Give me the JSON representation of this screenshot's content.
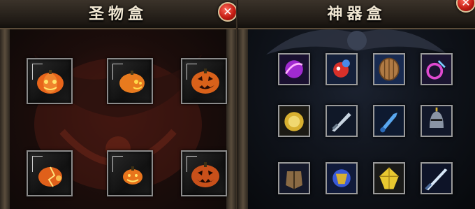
{
  "left_panel": {
    "title": "圣物盒",
    "close_label": "✕",
    "slots": [
      {
        "icon": "jack-o-lantern-glowing-icon"
      },
      {
        "icon": "jack-o-lantern-side-icon"
      },
      {
        "icon": "jack-o-lantern-grin-icon"
      },
      {
        "icon": "jack-o-lantern-cracked-icon"
      },
      {
        "icon": "jack-o-lantern-small-icon"
      },
      {
        "icon": "jack-o-lantern-dark-icon"
      }
    ]
  },
  "right_panel": {
    "title": "神器盒",
    "close_label": "✕",
    "items": [
      {
        "icon": "purple-orb-icon"
      },
      {
        "icon": "red-creature-icon"
      },
      {
        "icon": "wooden-shield-icon"
      },
      {
        "icon": "pink-pendant-icon"
      },
      {
        "icon": "gold-medallion-icon"
      },
      {
        "icon": "steel-sword-icon"
      },
      {
        "icon": "blue-dagger-icon"
      },
      {
        "icon": "knight-helmet-icon"
      },
      {
        "icon": "bronze-armor-icon"
      },
      {
        "icon": "golden-crest-icon"
      },
      {
        "icon": "gold-gem-icon"
      },
      {
        "icon": "silver-blade-icon"
      }
    ]
  },
  "colors": {
    "close_red": "#c41d14",
    "frame_gold": "#d8c49a",
    "title_text": "#f0e6d2"
  }
}
